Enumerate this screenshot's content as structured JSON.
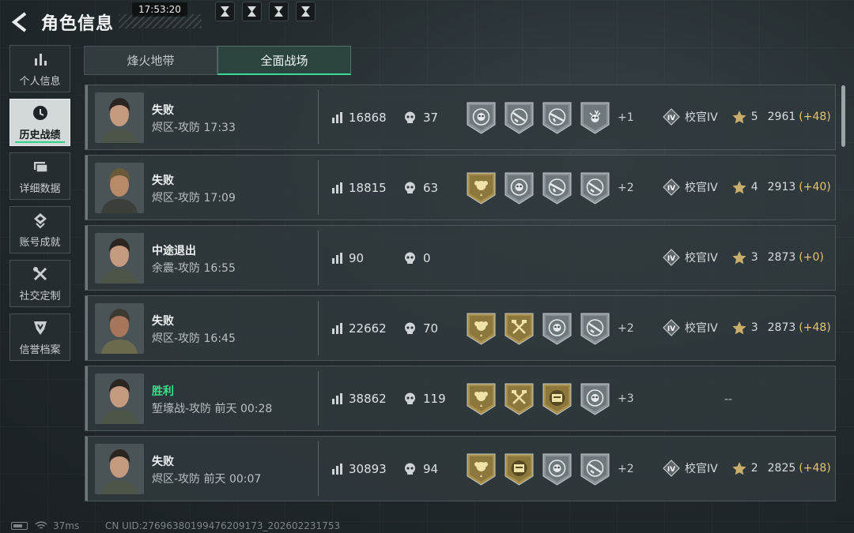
{
  "header": {
    "title": "角色信息",
    "time": "17:53:20",
    "top_icon_names": [
      "hourglass-icon",
      "hourglass-icon",
      "hourglass-icon",
      "hourglass-icon"
    ]
  },
  "sidebar": {
    "items": [
      {
        "label": "个人信息",
        "icon": "bar-chart-icon",
        "active": false
      },
      {
        "label": "历史战绩",
        "icon": "clock-icon",
        "active": true
      },
      {
        "label": "详细数据",
        "icon": "folder-icon",
        "active": false
      },
      {
        "label": "账号成就",
        "icon": "achievement-icon",
        "active": false
      },
      {
        "label": "社交定制",
        "icon": "tools-icon",
        "active": false
      },
      {
        "label": "信誉档案",
        "icon": "shield-icon",
        "active": false
      }
    ]
  },
  "tabs": [
    {
      "label": "烽火地带",
      "active": false
    },
    {
      "label": "全面战场",
      "active": true
    }
  ],
  "matches": [
    {
      "result": "失败",
      "win": false,
      "mode": "烬区-攻防 17:33",
      "score": "16868",
      "kills": "37",
      "badges": [
        "skull-silver",
        "gun-silver",
        "rifle-silver",
        "skull-spikes-silver"
      ],
      "extra": "+1",
      "rank": "校官IV",
      "stars": "5",
      "points": "2961",
      "delta": "(+48)"
    },
    {
      "result": "失败",
      "win": false,
      "mode": "烬区-攻防 17:09",
      "score": "18815",
      "kills": "63",
      "badges": [
        "rose-gold",
        "skull-silver",
        "rifle-silver",
        "gun-silver"
      ],
      "extra": "+2",
      "rank": "校官IV",
      "stars": "4",
      "points": "2913",
      "delta": "(+40)"
    },
    {
      "result": "中途退出",
      "win": false,
      "mode": "余震-攻防 16:55",
      "score": "90",
      "kills": "0",
      "badges": [],
      "extra": "",
      "rank": "校官IV",
      "stars": "3",
      "points": "2873",
      "delta": "(+0)"
    },
    {
      "result": "失败",
      "win": false,
      "mode": "烬区-攻防 16:45",
      "score": "22662",
      "kills": "70",
      "badges": [
        "rose-gold",
        "hammer-gold",
        "skull-silver",
        "gun-silver"
      ],
      "extra": "+2",
      "rank": "校官IV",
      "stars": "3",
      "points": "2873",
      "delta": "(+48)"
    },
    {
      "result": "胜利",
      "win": true,
      "mode": "堑壕战-攻防 前天 00:28",
      "score": "38862",
      "kills": "119",
      "badges": [
        "rose-gold",
        "hammer-gold",
        "crate-gold",
        "skull-silver"
      ],
      "extra": "+3",
      "rank": "",
      "stars": "",
      "points": "",
      "delta": "",
      "placeholder": "--"
    },
    {
      "result": "失败",
      "win": false,
      "mode": "烬区-攻防 前天 00:07",
      "score": "30893",
      "kills": "94",
      "badges": [
        "rose-gold",
        "crate-gold",
        "skull-silver",
        "gun-silver"
      ],
      "extra": "+2",
      "rank": "校官IV",
      "stars": "2",
      "points": "2825",
      "delta": "(+48)"
    }
  ],
  "footer": {
    "ping": "37ms",
    "uid": "CN UID:276963801994762091​73_202602231753"
  },
  "colors": {
    "accent": "#36e08c",
    "gold": "#e7c36a",
    "badge_gold": "#a8904c",
    "badge_silver": "#8b9599"
  }
}
